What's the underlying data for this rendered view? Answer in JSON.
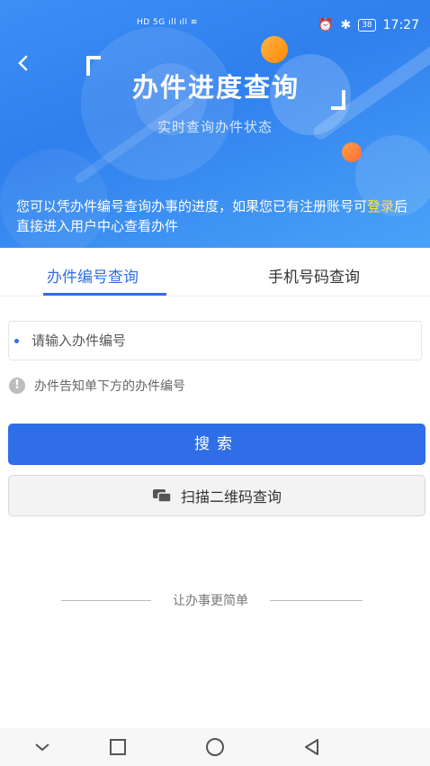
{
  "status_bar": {
    "network_left": "HD 5G",
    "time": "17:27",
    "battery": "38"
  },
  "header": {
    "title": "办件进度查询",
    "subtitle": "实时查询办件状态",
    "desc_before": "您可以凭办件编号查询办事的进度，如果您已有注册账号可",
    "desc_link": "登录",
    "desc_after": "后直接进入用户中心查看办件"
  },
  "tabs": [
    {
      "label": "办件编号查询",
      "active": true
    },
    {
      "label": "手机号码查询",
      "active": false
    }
  ],
  "search": {
    "placeholder": "请输入办件编号",
    "value": ""
  },
  "hint": "办件告知单下方的办件编号",
  "buttons": {
    "search": "搜索",
    "scan": "扫描二维码查询"
  },
  "footer": {
    "slogan": "让办事更简单"
  },
  "icons": {
    "back": "chevron-left-icon",
    "hint": "info-icon",
    "scan": "qr-scan-icon",
    "nav_down": "chevron-down-icon",
    "nav_recent": "square-icon",
    "nav_home": "circle-icon",
    "nav_back": "triangle-back-icon"
  },
  "colors": {
    "primary": "#2f6ee8",
    "header_bg": "#3d8ff5",
    "link": "#ffe14a"
  }
}
